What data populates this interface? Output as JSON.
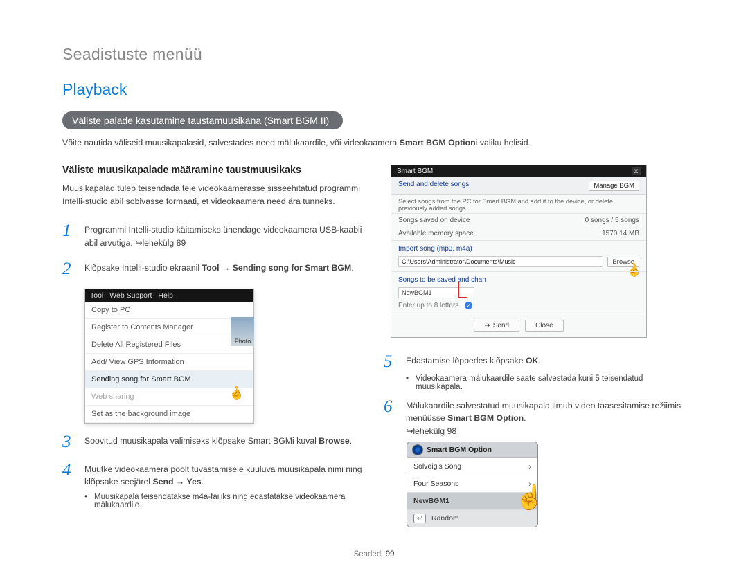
{
  "page": {
    "breadcrumb": "Seadistuste menüü",
    "section": "Playback",
    "tag_heading": "Väliste palade kasutamine taustamuusikana (Smart BGM II)",
    "lede_pre": "Võite nautida väliseid muusikapalasid, salvestades need mälukaardile, või videokaamera ",
    "lede_bold": "Smart BGM Option",
    "lede_post": "i valiku helisid."
  },
  "left": {
    "sub": "Väliste muusikapalade määramine taustmuusikaks",
    "body": "Muusikapalad tuleb teisendada teie videokaamerasse sisseehitatud programmi Intelli-studio abil sobivasse formaati, et videokaamera need ära tunneks.",
    "steps": {
      "s1": {
        "num": "1",
        "text": "Programmi Intelli-studio käitamiseks ühendage videokaamera USB-kaabli abil arvutiga. ",
        "arrow": "↪",
        "pageref": "lehekülg 89"
      },
      "s2": {
        "num": "2",
        "pre": "Klõpsake Intelli-studio ekraanil ",
        "b1": "Tool",
        "arrow": " → ",
        "b2": "Sending song for Smart BGM",
        "post": "."
      },
      "s3": {
        "num": "3",
        "pre": "Soovitud muusikapala valimiseks klõpsake Smart BGMi kuval ",
        "b1": "Browse",
        "post": "."
      },
      "s4": {
        "num": "4",
        "pre": "Muutke videokaamera poolt tuvastamisele kuuluva muusikapala nimi ning klõpsake seejärel ",
        "b1": "Send",
        "arrow": " → ",
        "b2": "Yes",
        "post": "."
      },
      "sub4": "Muusikapala teisendatakse m4a-failiks ning edastatakse videokaamera mälukaardile."
    },
    "appmenu": {
      "bar": {
        "tool": "Tool",
        "web": "Web Support",
        "help": "Help"
      },
      "items": {
        "copy": "Copy to PC",
        "reg": "Register to Contents Manager",
        "del": "Delete All Registered Files",
        "gps": "Add/ View GPS Information",
        "send": "Sending song for Smart BGM",
        "share": "Web sharing",
        "bg": "Set as the background image"
      },
      "photo_label": "Photo"
    }
  },
  "right": {
    "dialog": {
      "title": "Smart BGM",
      "head_label": "Send and delete songs",
      "manage_btn": "Manage BGM",
      "desc": "Select songs from the PC for Smart BGM and add it to the device, or delete previously added songs.",
      "kv1_k": "Songs saved on device",
      "kv1_v": "0 songs / 5 songs",
      "kv2_k": "Available memory space",
      "kv2_v": "1570.14 MB",
      "import_label": "Import song (mp3, m4a)",
      "path": "C:\\Users\\Administrator\\Documents\\Music",
      "browse": "Browse",
      "tosave_label": "Songs to be saved and chan",
      "songname": "NewBGM1",
      "limit": "Enter up to 8 letters.",
      "send": "Send",
      "close": "Close",
      "x": "x"
    },
    "steps": {
      "s5": {
        "num": "5",
        "pre": "Edastamise lõppedes klõpsake ",
        "b1": "OK",
        "post": "."
      },
      "sub5": "Videokaamera mälukaardile saate salvestada kuni 5 teisendatud muusikapala.",
      "s6": {
        "num": "6",
        "pre": "Mälukaardile salvestatud muusikapala ilmub video taasesitamise režiimis menüüsse ",
        "b1": "Smart BGM Option",
        "post": "."
      },
      "s6_arrow": "↪",
      "s6_pageref": "lehekülg 98"
    },
    "camlist": {
      "title": "Smart BGM Option",
      "i1": "Solveig's Song",
      "i2": "Four Seasons",
      "i3": "NewBGM1",
      "i4": "Random"
    }
  },
  "footer": {
    "label": "Seaded",
    "num": "99"
  }
}
